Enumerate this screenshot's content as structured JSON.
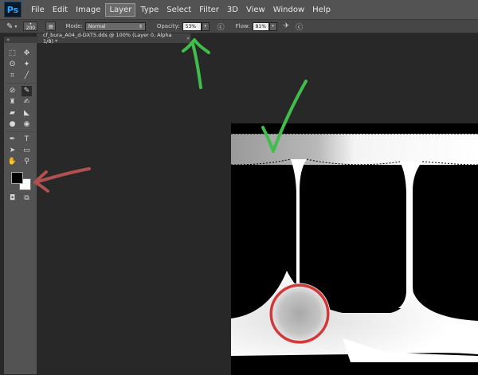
{
  "app": {
    "logo": "Ps"
  },
  "menu": [
    "File",
    "Edit",
    "Image",
    "Layer",
    "Type",
    "Select",
    "Filter",
    "3D",
    "View",
    "Window",
    "Help"
  ],
  "options": {
    "brush_size": "200",
    "mode_label": "Mode:",
    "mode_value": "Normal",
    "opacity_label": "Opacity:",
    "opacity_value": "53%",
    "flow_label": "Flow:",
    "flow_value": "81%"
  },
  "document": {
    "tab_title": "cf_bura_A04_d-DXT5.dds @ 100% (Layer 0, Alpha 1/8) *",
    "close_label": "×"
  },
  "icons": [
    "brush-icon",
    "move-icon",
    "marquee-icon",
    "lasso-icon",
    "magic-wand-icon",
    "crop-icon",
    "eyedropper-icon",
    "healing-brush-icon",
    "brush-tool-icon",
    "clone-stamp-icon",
    "history-brush-icon",
    "eraser-icon",
    "gradient-icon",
    "blur-icon",
    "dodge-icon",
    "pen-icon",
    "type-icon",
    "path-selection-icon",
    "rectangle-icon",
    "hand-icon",
    "zoom-icon"
  ],
  "colors": {
    "annotation_green": "#3fbf4a",
    "annotation_red": "#b05050",
    "ring_red": "#d03a3a",
    "foreground": "#000000",
    "background": "#ffffff"
  }
}
